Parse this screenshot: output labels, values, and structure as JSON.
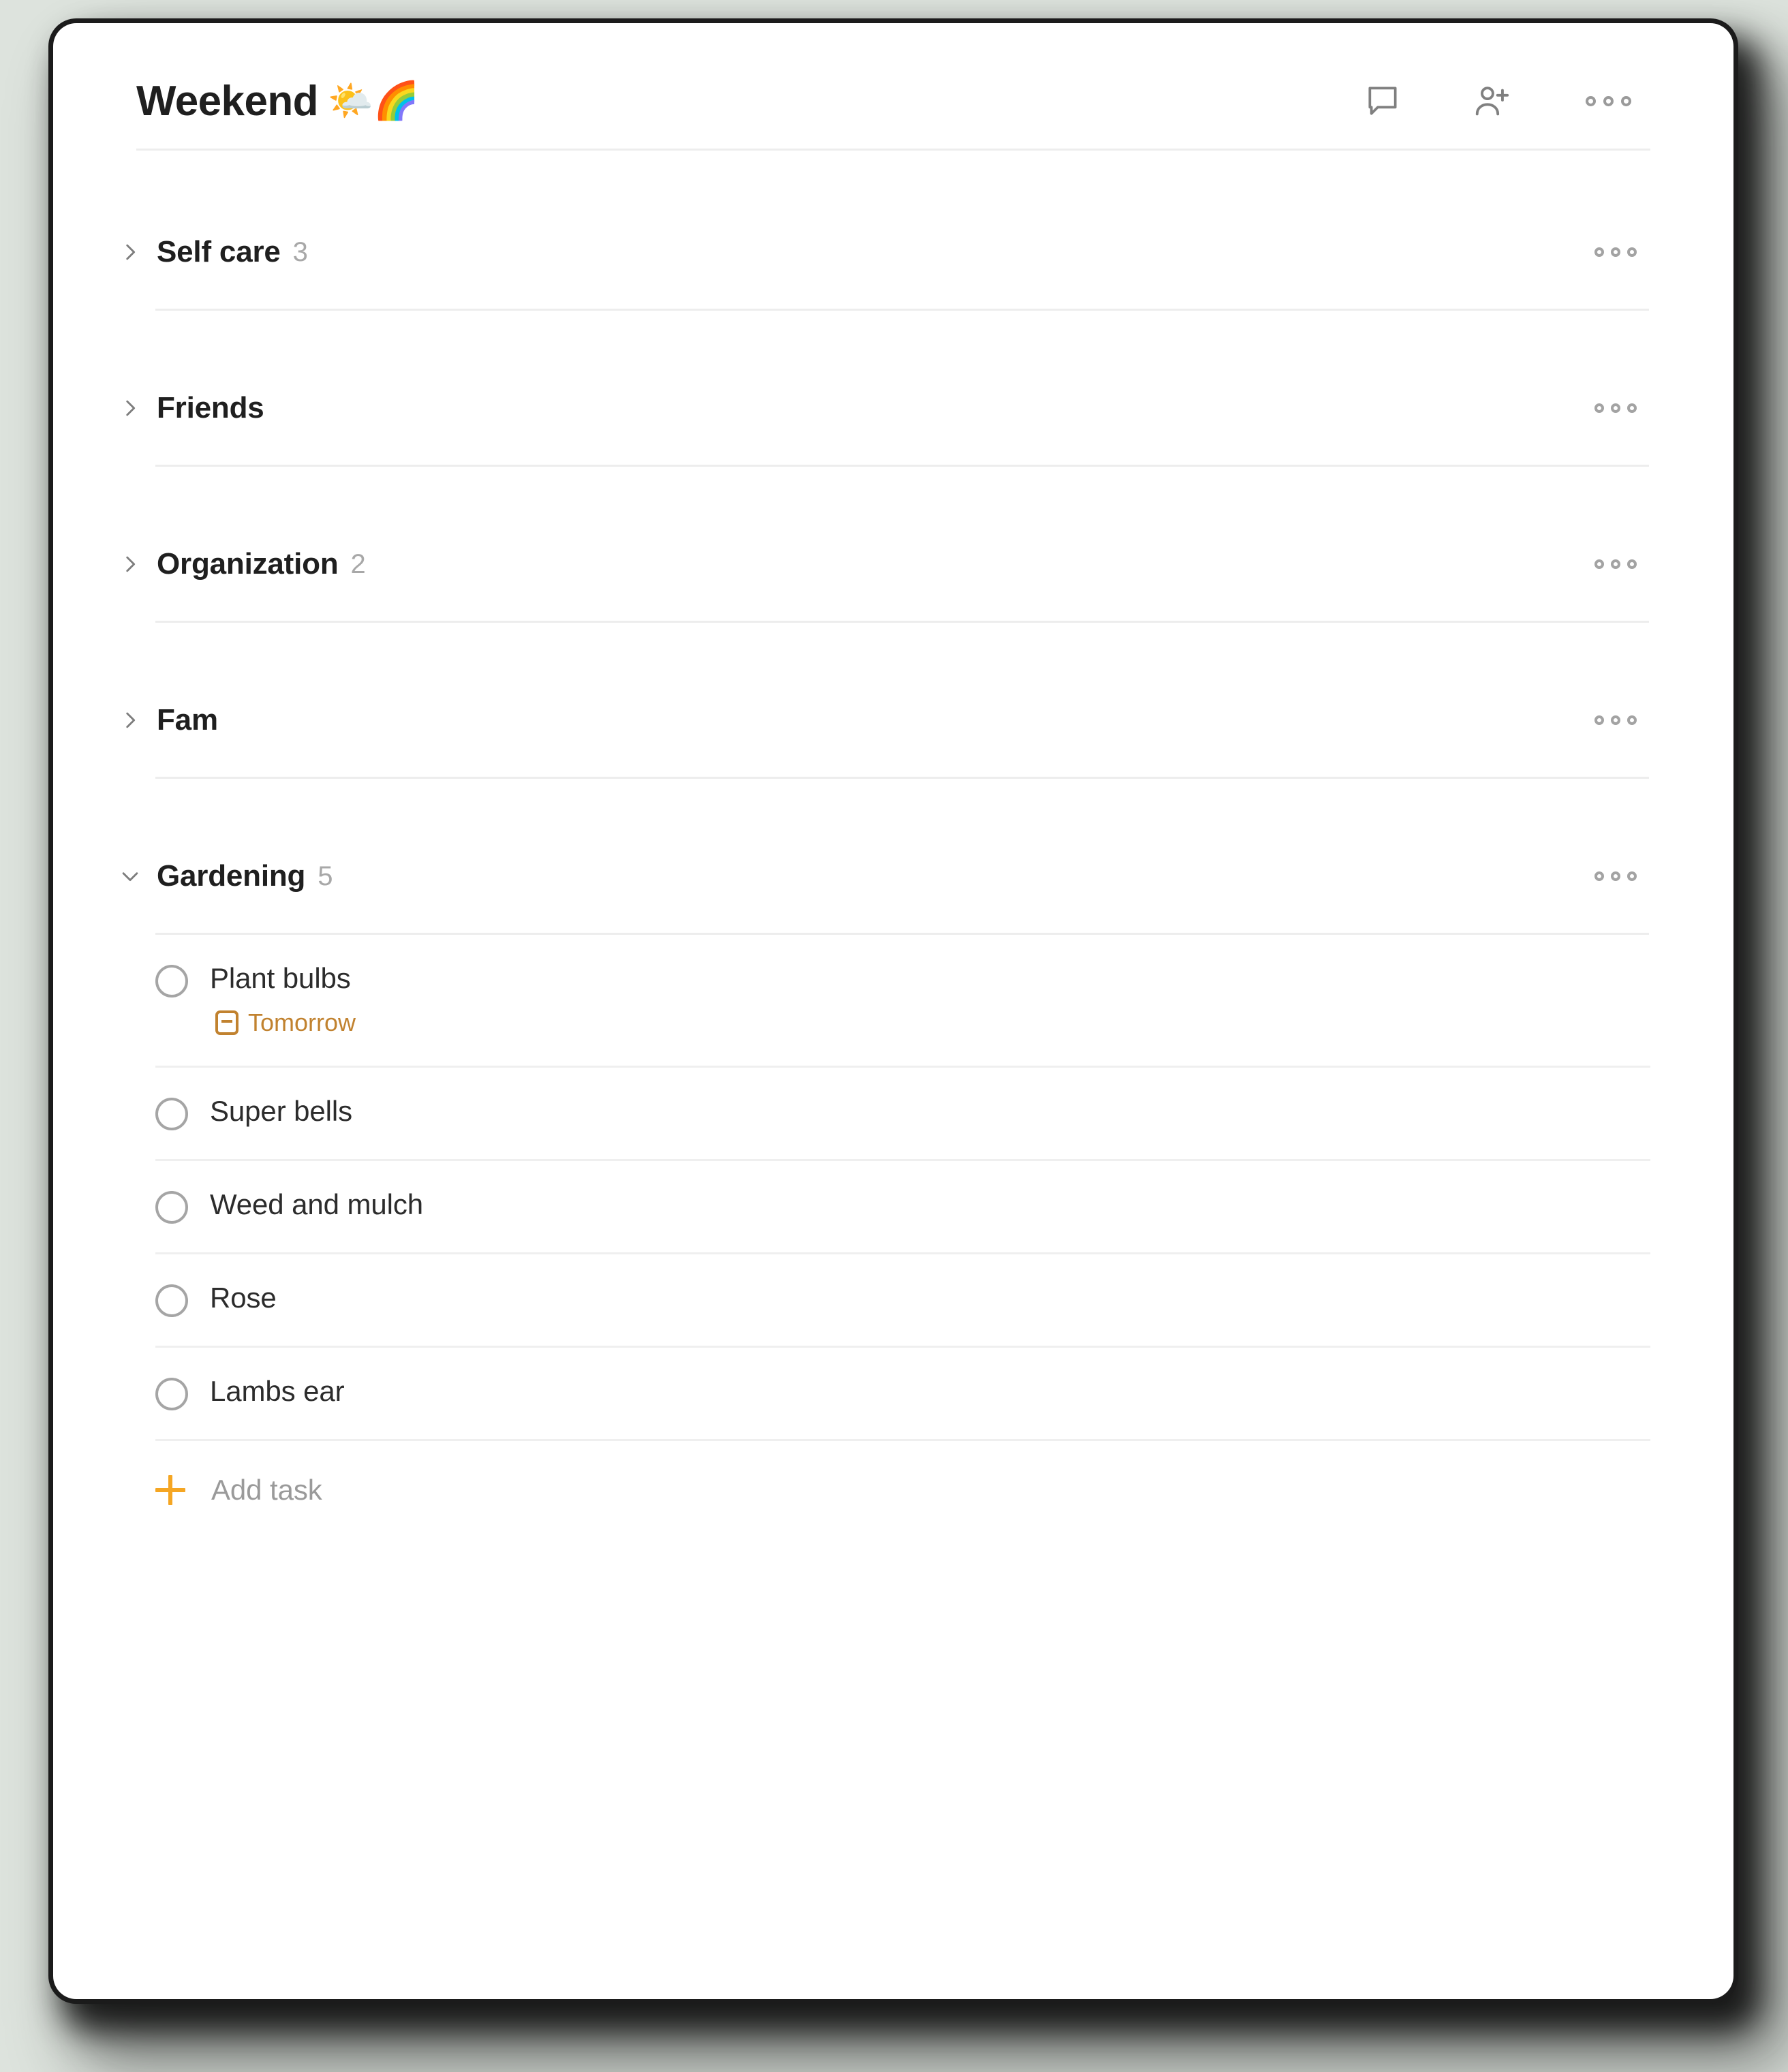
{
  "window": {
    "background_color": "#dde3dd",
    "card_color": "#ffffff"
  },
  "header": {
    "title": "Weekend",
    "emoji": "🌤️🌈",
    "actions": [
      {
        "name": "comments-icon",
        "label": "Comments"
      },
      {
        "name": "add-person-icon",
        "label": "Add person"
      },
      {
        "name": "more-menu-icon",
        "label": "More actions"
      }
    ]
  },
  "colors": {
    "accent_orange": "#f5a623",
    "due_orange": "#c1822f",
    "text_primary": "#1f1f1f",
    "text_secondary": "#9a9a9a",
    "rule": "#ededed"
  },
  "sections": [
    {
      "name": "Self care",
      "count": "3",
      "expanded": false,
      "menu_label": "Section actions",
      "tasks": []
    },
    {
      "name": "Friends",
      "count": "",
      "expanded": false,
      "menu_label": "Section actions",
      "tasks": []
    },
    {
      "name": "Organization",
      "count": "2",
      "expanded": false,
      "menu_label": "Section actions",
      "tasks": []
    },
    {
      "name": "Fam",
      "count": "",
      "expanded": false,
      "menu_label": "Section actions",
      "tasks": []
    },
    {
      "name": "Gardening",
      "count": "5",
      "expanded": true,
      "menu_label": "Section actions",
      "add_task_label": "Add task",
      "tasks": [
        {
          "title": "Plant bulbs",
          "due": "Tomorrow",
          "completed": false
        },
        {
          "title": "Super bells",
          "due": "",
          "completed": false
        },
        {
          "title": "Weed and mulch",
          "due": "",
          "completed": false
        },
        {
          "title": "Rose",
          "due": "",
          "completed": false
        },
        {
          "title": "Lambs ear",
          "due": "",
          "completed": false
        }
      ]
    }
  ]
}
